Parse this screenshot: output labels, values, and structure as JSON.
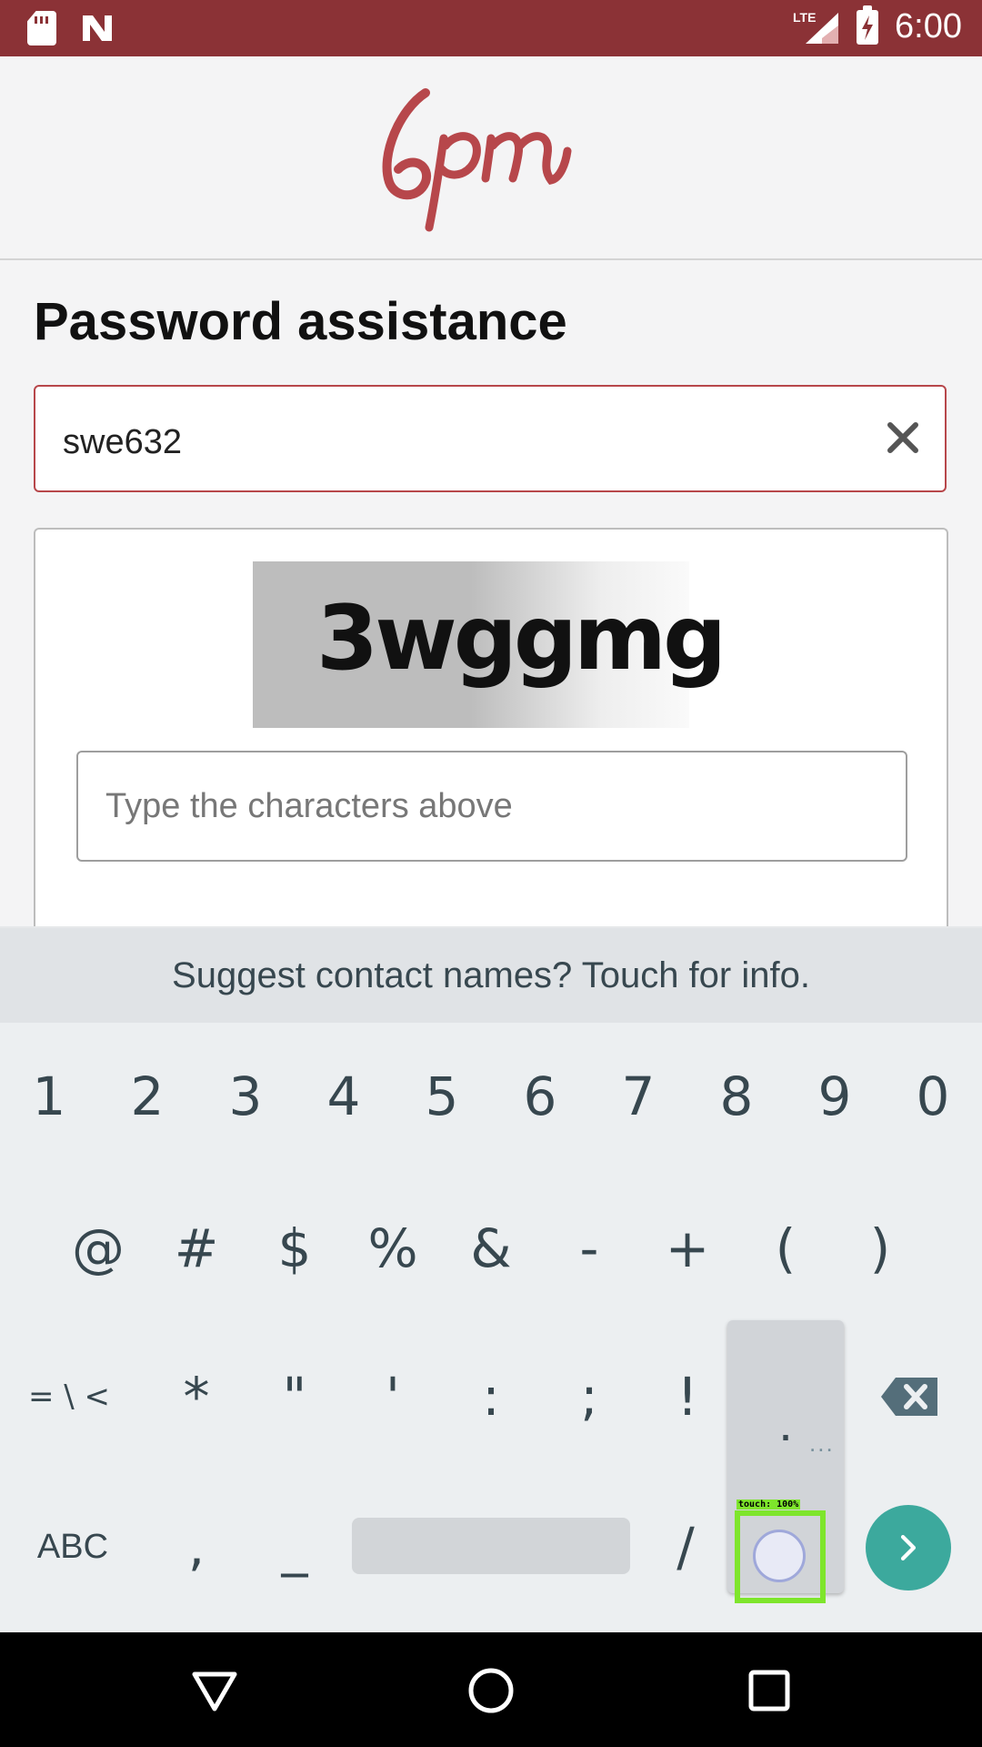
{
  "status_bar": {
    "time": "6:00",
    "network": "LTE",
    "icons": [
      "sd-card-icon",
      "n-notification-icon",
      "lte-signal-icon",
      "battery-charging-icon"
    ]
  },
  "header": {
    "logo_text": "6pm",
    "brand_color": "#b7474b"
  },
  "form": {
    "title": "Password assistance",
    "email_value": "swe632",
    "captcha_text": "3wggmg",
    "captcha_placeholder": "Type the characters above"
  },
  "keyboard": {
    "suggestion": "Suggest contact names? Touch for info.",
    "row1": [
      "1",
      "2",
      "3",
      "4",
      "5",
      "6",
      "7",
      "8",
      "9",
      "0"
    ],
    "row2": [
      "@",
      "#",
      "$",
      "%",
      "&",
      "-",
      "+",
      "(",
      ")"
    ],
    "row3": [
      "= \\ <",
      "*",
      "\"",
      "'",
      ":",
      ";",
      "!",
      ".",
      ""
    ],
    "row4": [
      "ABC",
      ",",
      "_",
      "",
      "/"
    ],
    "popup_key": ".",
    "popup_more": "...",
    "touch_label": "touch: 100%"
  },
  "colors": {
    "status_bar": "#8b3236",
    "enter_key": "#3ca99d",
    "touch_highlight": "#7ee52c"
  }
}
